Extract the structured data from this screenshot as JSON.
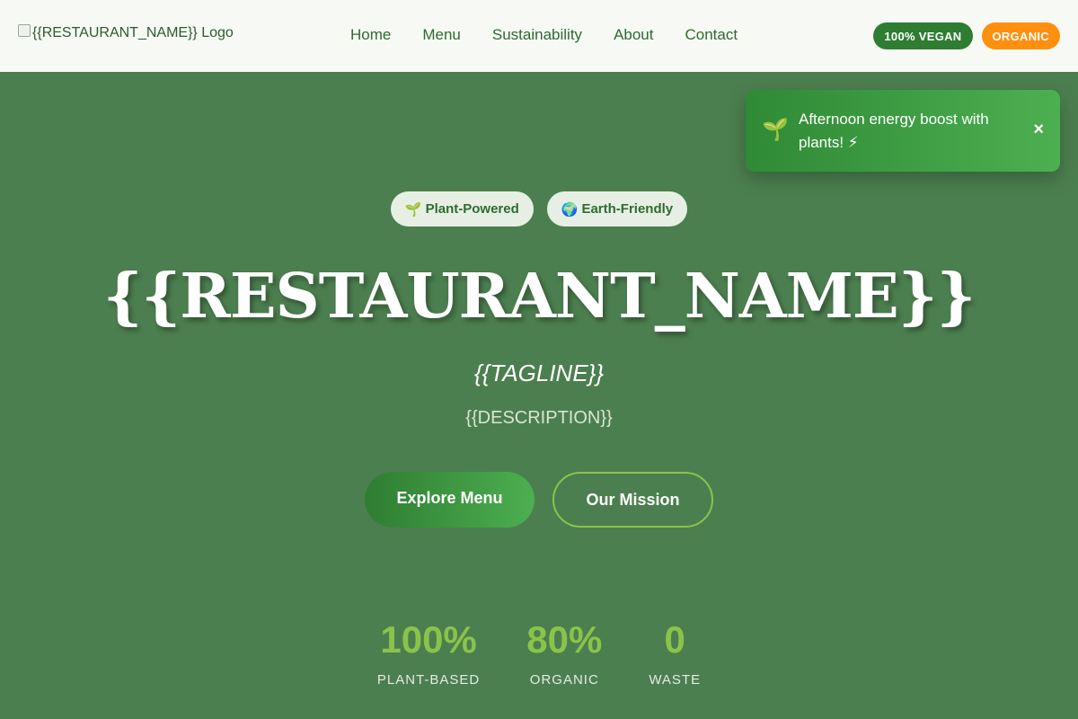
{
  "header": {
    "logo_alt": "{{RESTAURANT_NAME}} Logo",
    "nav": [
      "Home",
      "Menu",
      "Sustainability",
      "About",
      "Contact"
    ],
    "badges": [
      "100% VEGAN",
      "ORGANIC"
    ]
  },
  "toast": {
    "icon": "🌱",
    "message": "Afternoon energy boost with plants! ⚡",
    "close": "×"
  },
  "hero": {
    "pills": [
      {
        "icon": "🌱",
        "label": "Plant-Powered"
      },
      {
        "icon": "🌍",
        "label": "Earth-Friendly"
      }
    ],
    "title": "{{RESTAURANT_NAME}}",
    "tagline": "{{TAGLINE}}",
    "description": "{{DESCRIPTION}}",
    "primary_button": "Explore Menu",
    "secondary_button": "Our Mission"
  },
  "stats": [
    {
      "value": "100%",
      "label": "PLANT-BASED"
    },
    {
      "value": "80%",
      "label": "ORGANIC"
    },
    {
      "value": "0",
      "label": "WASTE"
    }
  ],
  "colors": {
    "hero_bg": "#4c7f4f",
    "header_bg": "#f6f9f4",
    "accent_green": "#2e7d32",
    "accent_light_green": "#8bc34a",
    "accent_orange": "#ff8f0f"
  }
}
